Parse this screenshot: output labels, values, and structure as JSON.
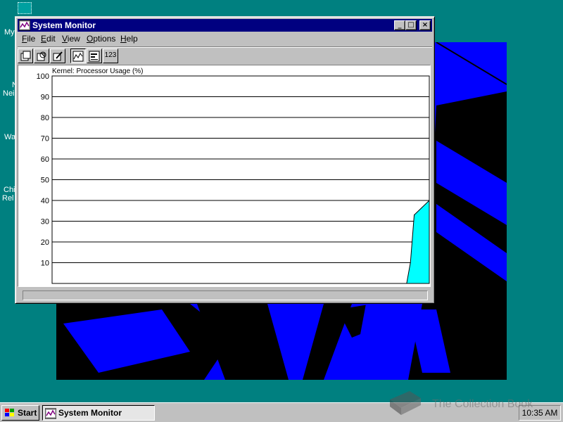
{
  "desktop": {
    "icons": [
      {
        "label": "My"
      },
      {
        "label": "N"
      },
      {
        "label": "Nei"
      },
      {
        "label": "Wa"
      },
      {
        "label": "Chi"
      },
      {
        "label": "Rel"
      }
    ]
  },
  "window": {
    "title": "System Monitor",
    "controls": {
      "minimize": "_",
      "maximize": "□",
      "close": "×"
    },
    "menu": [
      {
        "label": "File",
        "accel": "F",
        "rest": "ile"
      },
      {
        "label": "Edit",
        "accel": "E",
        "rest": "dit"
      },
      {
        "label": "View",
        "accel": "V",
        "rest": "iew"
      },
      {
        "label": "Options",
        "accel": "O",
        "rest": "ptions"
      },
      {
        "label": "Help",
        "accel": "H",
        "rest": "elp"
      }
    ],
    "toolbar": [
      {
        "name": "add-item-icon"
      },
      {
        "name": "remove-item-icon"
      },
      {
        "name": "edit-item-icon"
      },
      {
        "name": "line-chart-view-icon",
        "pressed": true
      },
      {
        "name": "bar-chart-view-icon"
      },
      {
        "name": "numeric-view-icon",
        "text": "123"
      }
    ]
  },
  "chart_data": {
    "type": "area",
    "title": "Kernel: Processor Usage (%)",
    "ylim": [
      0,
      100
    ],
    "yticks": [
      "100",
      "90",
      "80",
      "70",
      "60",
      "50",
      "40",
      "30",
      "20",
      "10"
    ],
    "grid": true,
    "fill_color": "#00ffff",
    "series": [
      {
        "x": [
          0,
          94,
          95,
          96,
          100
        ],
        "values": [
          0,
          0,
          10,
          33,
          40
        ]
      }
    ]
  },
  "taskbar": {
    "start_label": "Start",
    "task_label": "System Monitor",
    "clock": "10:35 AM"
  },
  "watermark": {
    "text": "The Collection Book"
  },
  "colors": {
    "desktop": "#008080",
    "titlebar": "#000080",
    "face": "#c0c0c0",
    "wallpaper_blue": "#0000ff"
  }
}
